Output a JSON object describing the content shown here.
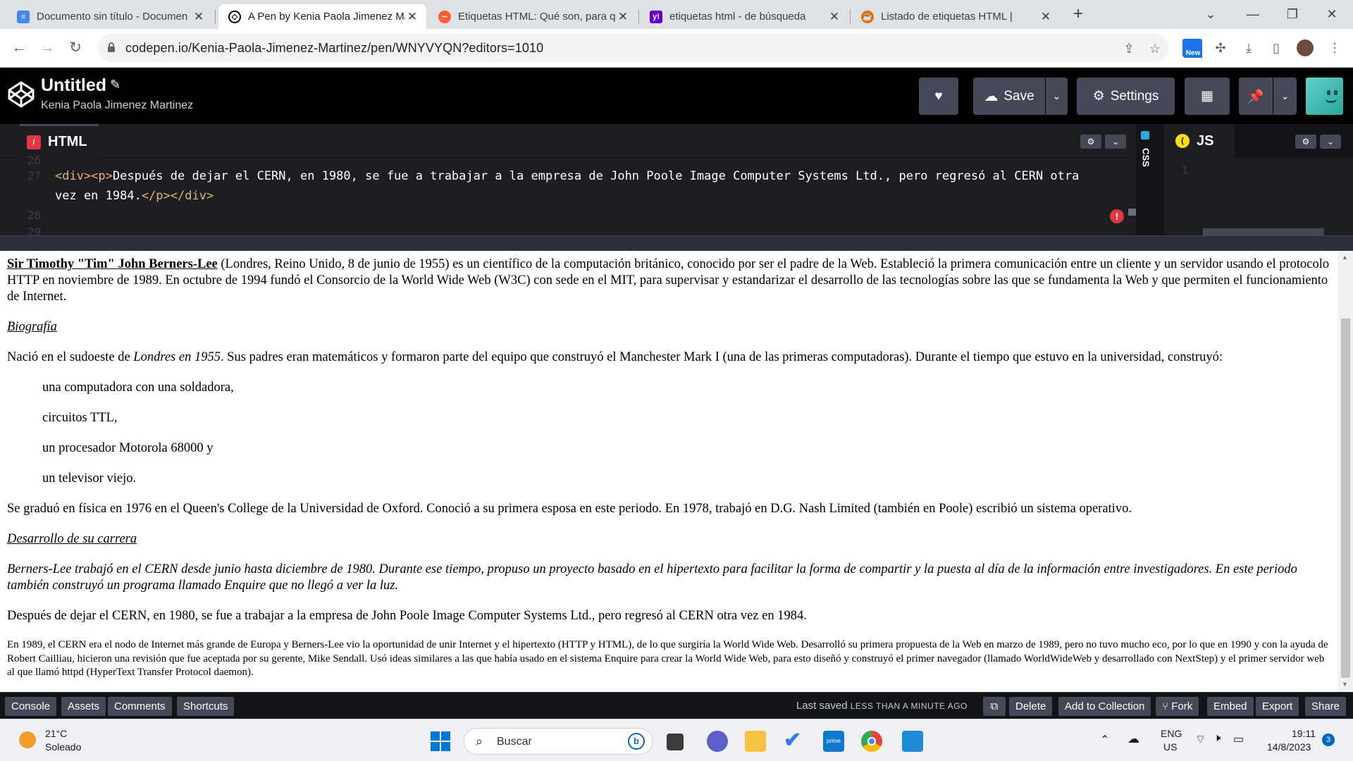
{
  "browser": {
    "tabs": [
      {
        "title": "Documento sin título - Documen",
        "favicon": "google-docs-icon",
        "color": "#4285f4"
      },
      {
        "title": "A Pen by Kenia Paola Jimenez Ma",
        "favicon": "codepen-icon",
        "color": "#000000"
      },
      {
        "title": "Etiquetas HTML: Qué son, para q",
        "favicon": "hubspot-icon",
        "color": "#ff5c35"
      },
      {
        "title": "etiquetas html - de búsqueda",
        "favicon": "yahoo-icon",
        "color": "#6001d2"
      },
      {
        "title": "Listado de etiquetas HTML |",
        "favicon": "java-icon",
        "color": "#e76f00"
      }
    ],
    "new_tab_label": "+",
    "url": "codepen.io/Kenia-Paola-Jimenez-Martinez/pen/WNYVYQN?editors=1010",
    "extension_badge": "New"
  },
  "codepen": {
    "title": "Untitled",
    "author": "Kenia Paola Jimenez Martinez",
    "save_label": "Save",
    "settings_label": "Settings",
    "html_tab": "HTML",
    "css_tab": "CSS",
    "js_tab": "JS",
    "code": {
      "line_numbers": [
        "26",
        "27",
        "",
        "28",
        "29"
      ],
      "js_line": "1",
      "line27_open": "<div><p>",
      "line27_text": "Después de dejar el CERN, en 1980, se fue a trabajar a la empresa de John Poole Image Computer Systems Ltd., pero regresó al CERN otra",
      "line27_cont_text": "vez en 1984.",
      "line27_close": "</p></div>"
    },
    "footer": {
      "console": "Console",
      "assets": "Assets",
      "comments": "Comments",
      "shortcuts": "Shortcuts",
      "last_saved": "Last saved",
      "last_saved_time": "LESS THAN A MINUTE AGO",
      "delete": "Delete",
      "add_to_collection": "Add to Collection",
      "fork": "Fork",
      "embed": "Embed",
      "export": "Export",
      "share": "Share"
    }
  },
  "preview": {
    "intro_name": "Sir Timothy \"Tim\" John Berners-Lee",
    "intro_rest": " (Londres, Reino Unido, 8 de junio de 1955) es un científico de la computación británico, conocido por ser el padre de la Web. Estableció la primera comunicación entre un cliente y un servidor usando el protocolo HTTP en noviembre de 1989. En octubre de 1994 fundó el Consorcio de la World Wide Web (W3C) con sede en el MIT, para supervisar y estandarizar el desarrollo de las tecnologías sobre las que se fundamenta la Web y que permiten el funcionamiento de Internet.",
    "heading_bio": "Biografía",
    "bio_a": "Nació en el sudoeste de ",
    "bio_em": "Londres en 1955",
    "bio_b": ". Sus padres eran matemáticos y formaron parte del equipo que construyó el Manchester Mark I (una de las primeras computadoras). Durante el tiempo que estuvo en la universidad, construyó:",
    "items": [
      "una computadora con una soldadora,",
      "circuitos TTL,",
      "un procesador Motorola 68000 y",
      "un televisor viejo."
    ],
    "graduated": "Se graduó en física en 1976 en el Queen's College de la Universidad de Oxford. Conoció a su primera esposa en este periodo. En 1978, trabajó en D.G. Nash Limited (también en Poole) escribió un sistema operativo.",
    "heading_career": "Desarrollo de su carrera",
    "career_italic": "Berners-Lee trabajó en el CERN desde junio hasta diciembre de 1980. Durante ese tiempo, propuso un proyecto basado en el hipertexto para facilitar la forma de compartir y la puesta al día de la información entre investigadores. En este periodo también construyó un programa llamado Enquire que no llegó a ver la luz.",
    "after_cern": "Después de dejar el CERN, en 1980, se fue a trabajar a la empresa de John Poole Image Computer Systems Ltd., pero regresó al CERN otra vez en 1984.",
    "small_para": "En 1989, el CERN era el nodo de Internet más grande de Europa y Berners-Lee vio la oportunidad de unir Internet y el hipertexto (HTTP y HTML), de lo que surgiría la World Wide Web. Desarrolló su primera propuesta de la Web en marzo de 1989, pero no tuvo mucho eco, por lo que en 1990 y con la ayuda de Robert Cailliau, hicieron una revisión que fue aceptada por su gerente, Mike Sendall. Usó ideas similares a las que había usado en el sistema Enquire para crear la World Wide Web, para esto diseñó y construyó el primer navegador (llamado WorldWideWeb y desarrollado con NextStep) y el primer servidor web al que llamó httpd (HyperText Transfer Protocol daemon)."
  },
  "taskbar": {
    "temp": "21°C",
    "condition": "Soleado",
    "search": "Buscar",
    "lang1": "ENG",
    "lang2": "US",
    "time": "19:11",
    "date": "14/8/2023",
    "notif_count": "3"
  }
}
